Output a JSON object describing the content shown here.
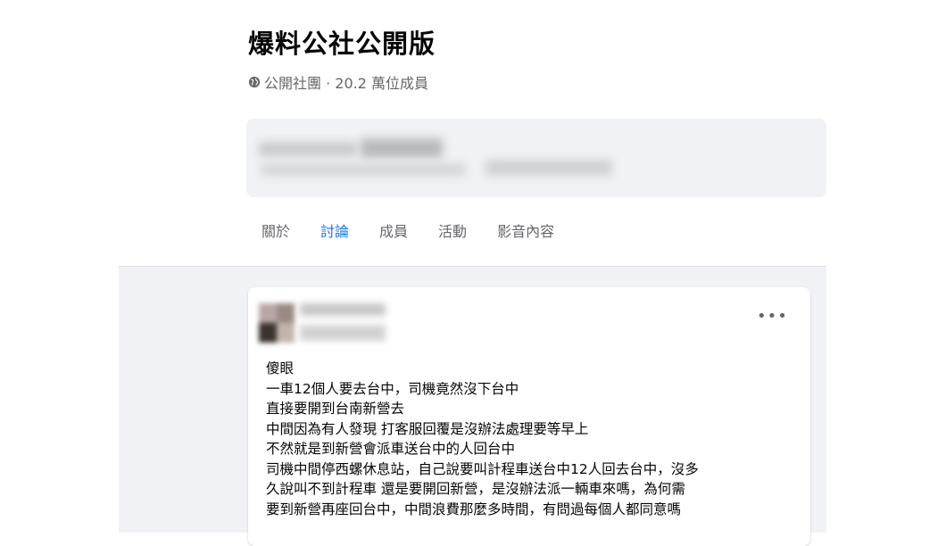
{
  "group": {
    "name": "爆料公社公開版",
    "meta": "公開社團 · 20.2 萬位成員"
  },
  "tabs": [
    {
      "label": "關於",
      "active": false
    },
    {
      "label": "討論",
      "active": true
    },
    {
      "label": "成員",
      "active": false
    },
    {
      "label": "活動",
      "active": false
    },
    {
      "label": "影音內容",
      "active": false
    }
  ],
  "post": {
    "more_label": "•••",
    "lines": [
      "傻眼",
      "一車12個人要去台中，司機竟然沒下台中",
      "直接要開到台南新營去",
      "中間因為有人發現 打客服回覆是沒辦法處理要等早上",
      "不然就是到新營會派車送台中的人回台中",
      "司機中間停西螺休息站，自己說要叫計程車送台中12人回去台中，沒多",
      "久說叫不到計程車 還是要開回新營，是沒辦法派一輛車來嗎，為何需",
      "要到新營再座回台中，中間浪費那麼多時間，有問過每個人都同意嗎"
    ]
  },
  "colors": {
    "accent": "#1877f2",
    "muted": "#65676b",
    "feed_bg": "#f0f2f5"
  }
}
